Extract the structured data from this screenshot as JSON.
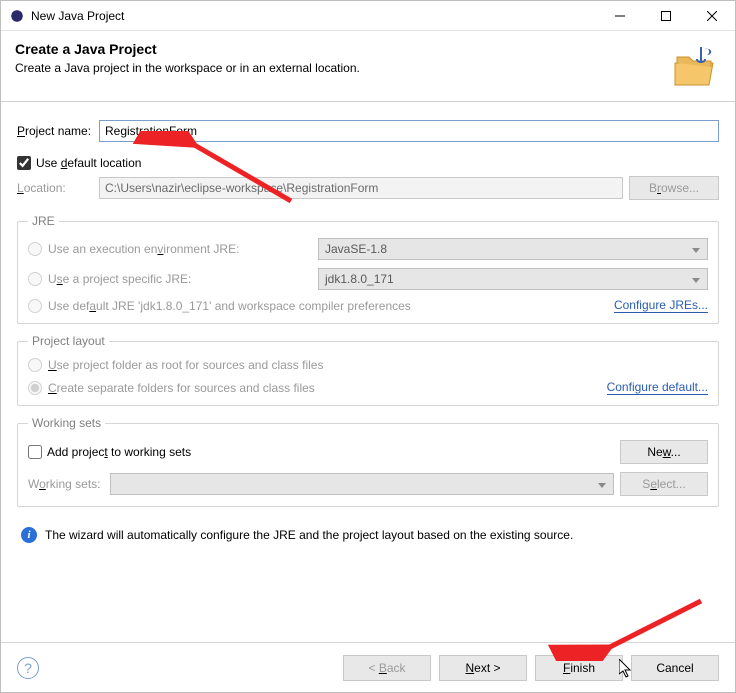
{
  "window": {
    "title": "New Java Project"
  },
  "header": {
    "title": "Create a Java Project",
    "subtitle": "Create a Java project in the workspace or in an external location."
  },
  "projectName": {
    "label": "Project name:",
    "value": "RegistrationForm"
  },
  "useDefault": {
    "label": "Use default location",
    "checked": true
  },
  "location": {
    "label": "Location:",
    "value": "C:\\Users\\nazir\\eclipse-workspace\\RegistrationForm",
    "browse": "Browse..."
  },
  "jre": {
    "legend": "JRE",
    "opt1": {
      "label": "Use an execution environment JRE:",
      "value": "JavaSE-1.8"
    },
    "opt2": {
      "label": "Use a project specific JRE:",
      "value": "jdk1.8.0_171"
    },
    "opt3": {
      "label": "Use default JRE 'jdk1.8.0_171' and workspace compiler preferences"
    },
    "configure": "Configure JREs..."
  },
  "layout": {
    "legend": "Project layout",
    "opt1": "Use project folder as root for sources and class files",
    "opt2": "Create separate folders for sources and class files",
    "configure": "Configure default..."
  },
  "workingSets": {
    "legend": "Working sets",
    "add": "Add project to working sets",
    "new": "New...",
    "label": "Working sets:",
    "select": "Select..."
  },
  "info": "The wizard will automatically configure the JRE and the project layout based on the existing source.",
  "footer": {
    "back": "< Back",
    "next": "Next >",
    "finish": "Finish",
    "cancel": "Cancel"
  }
}
